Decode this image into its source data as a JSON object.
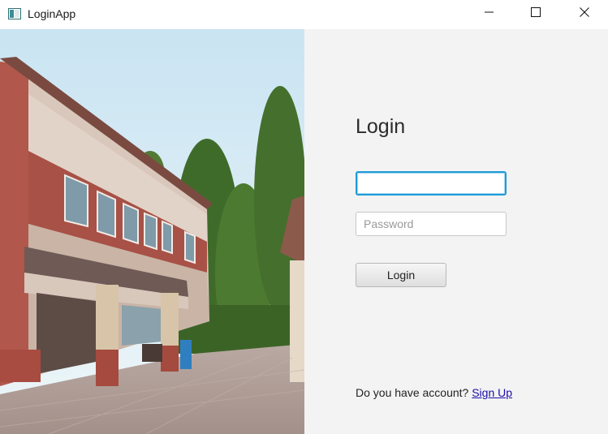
{
  "window": {
    "title": "LoginApp",
    "icons": {
      "app": "app-window-icon",
      "minimize": "minimize-icon",
      "maximize": "maximize-icon",
      "close": "close-icon"
    }
  },
  "form": {
    "heading": "Login",
    "username": {
      "value": "",
      "placeholder": ""
    },
    "password": {
      "value": "",
      "placeholder": "Password"
    },
    "login_label": "Login",
    "signup_prompt": "Do you have account?",
    "signup_link": "Sign Up",
    "colors": {
      "focus_border": "#1e9bd7",
      "link": "#1a0dab",
      "panel_bg": "#f3f3f3"
    }
  }
}
